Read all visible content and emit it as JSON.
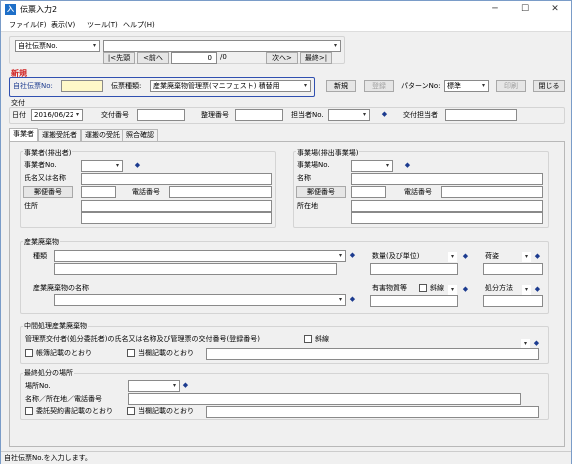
{
  "window": {
    "title": "伝票入力2",
    "minimize": "─",
    "maximize": "☐",
    "close": "✕"
  },
  "menu": [
    "ファイル(F)",
    "表示(V)",
    "ツール(T)",
    "ヘルプ(H)"
  ],
  "nav": {
    "selector_value": "自社伝票No.",
    "first": "|<先頭",
    "prev": "<前へ",
    "current": "0",
    "total": "/0",
    "next": "次へ>",
    "last": "最終>|"
  },
  "header": {
    "status": "新規",
    "slip_no_label": "自社伝票No:",
    "type_label": "伝票種類:",
    "type_value": "産業廃棄物管理票(マニフェスト) 積替用",
    "new_button": "新規",
    "register_button": "登録",
    "pattern_label": "パターンNo:",
    "pattern_value": "標準",
    "print_button": "印刷",
    "close_button": "閉じる"
  },
  "issue": {
    "section": "交付",
    "date_label": "日付",
    "date_value": "2016/06/22",
    "doc_no_label": "交付番号",
    "arrange_no_label": "整理番号",
    "person_no_label": "担当者No.",
    "person_label": "交付担当者"
  },
  "tabs": [
    "事業者",
    "運搬受託者",
    "運搬の受託",
    "照合確認"
  ],
  "business": {
    "section": "事業者(排出者)",
    "no_label": "事業者No.",
    "name_label": "氏名又は名称",
    "zip_button": "郵便番号",
    "phone_label": "電話番号",
    "address_label": "住所"
  },
  "site": {
    "section": "事業場(排出事業場)",
    "no_label": "事業場No.",
    "name_label": "名称",
    "zip_button": "郵便番号",
    "phone_label": "電話番号",
    "location_label": "所在地"
  },
  "waste": {
    "section": "産業廃棄物",
    "kind_label": "種類",
    "qty_label": "数量(及び単位)",
    "form_label": "荷姿",
    "name_label": "産業廃棄物の名称",
    "hazard_label": "有害物質等",
    "slash_label": "斜線",
    "method_label": "処分方法"
  },
  "intermediate": {
    "section": "中間処理産業廃棄物",
    "desc": "管理票交付者(処分委託者)の氏名又は名称及び管理票の交付番号(登録番号)",
    "slash_label": "斜線",
    "ledger_label": "帳簿記載のとおり",
    "column_label": "当欄記載のとおり"
  },
  "final": {
    "section": "最終処分の場所",
    "place_no_label": "場所No.",
    "name_label": "名称／所在地／電話番号",
    "contract_label": "委託契約書記載のとおり",
    "column_label": "当欄記載のとおり"
  },
  "status": "自社伝票No.を入力します。"
}
